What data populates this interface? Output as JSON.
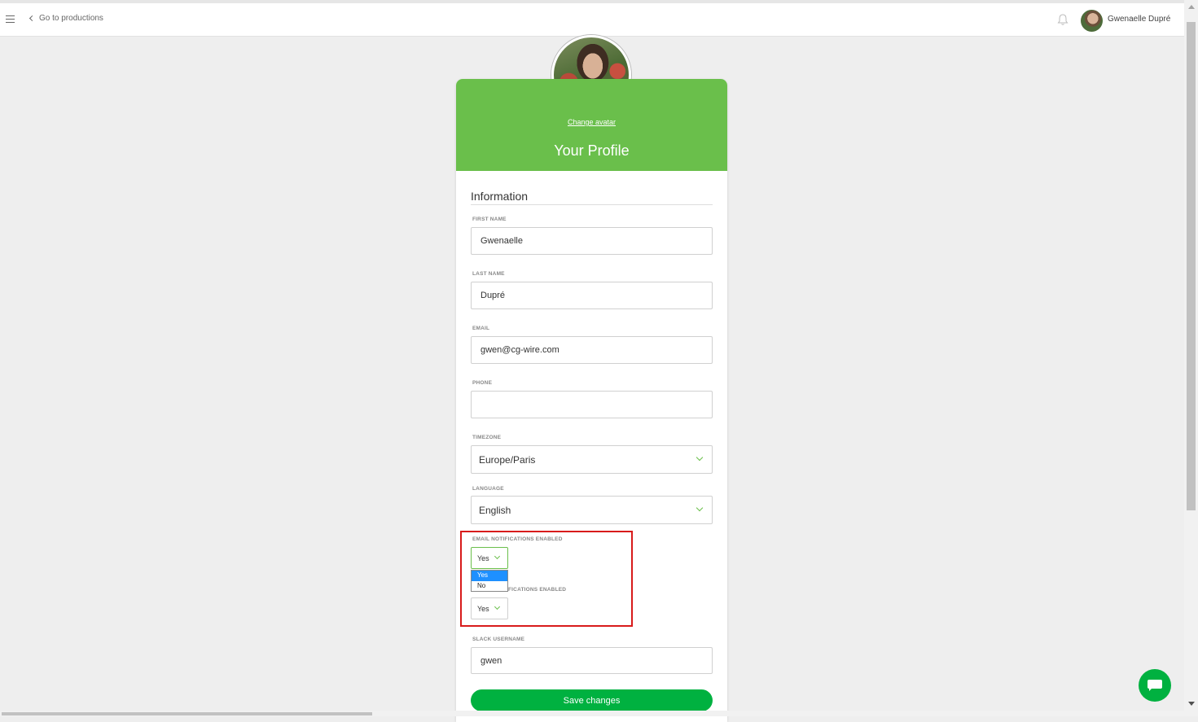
{
  "topbar": {
    "back_label": "Go to productions",
    "user_name": "Gwenaelle Dupré",
    "icons": [
      "menu-icon",
      "chevron-left-icon",
      "bell-icon"
    ]
  },
  "profile": {
    "change_avatar": "Change avatar",
    "title": "Your Profile",
    "section_title": "Information",
    "fields": {
      "first_name": {
        "label": "FIRST NAME",
        "value": "Gwenaelle"
      },
      "last_name": {
        "label": "LAST NAME",
        "value": "Dupré"
      },
      "email": {
        "label": "EMAIL",
        "value": "gwen@cg-wire.com"
      },
      "phone": {
        "label": "PHONE",
        "value": ""
      },
      "timezone": {
        "label": "TIMEZONE",
        "value": "Europe/Paris"
      },
      "language": {
        "label": "LANGUAGE",
        "value": "English"
      },
      "email_notifications": {
        "label": "EMAIL NOTIFICATIONS ENABLED",
        "value": "Yes",
        "options": [
          "Yes",
          "No"
        ]
      },
      "slack_notifications": {
        "label_visible": "FICATIONS ENABLED",
        "value": "Yes"
      },
      "slack_username": {
        "label": "SLACK USERNAME",
        "value": "gwen"
      }
    },
    "save_label": "Save changes"
  },
  "colors": {
    "header_green": "#6abf4b",
    "button_green": "#00b140",
    "highlight_red": "#d81b1b",
    "selected_option_blue": "#1e90ff"
  }
}
